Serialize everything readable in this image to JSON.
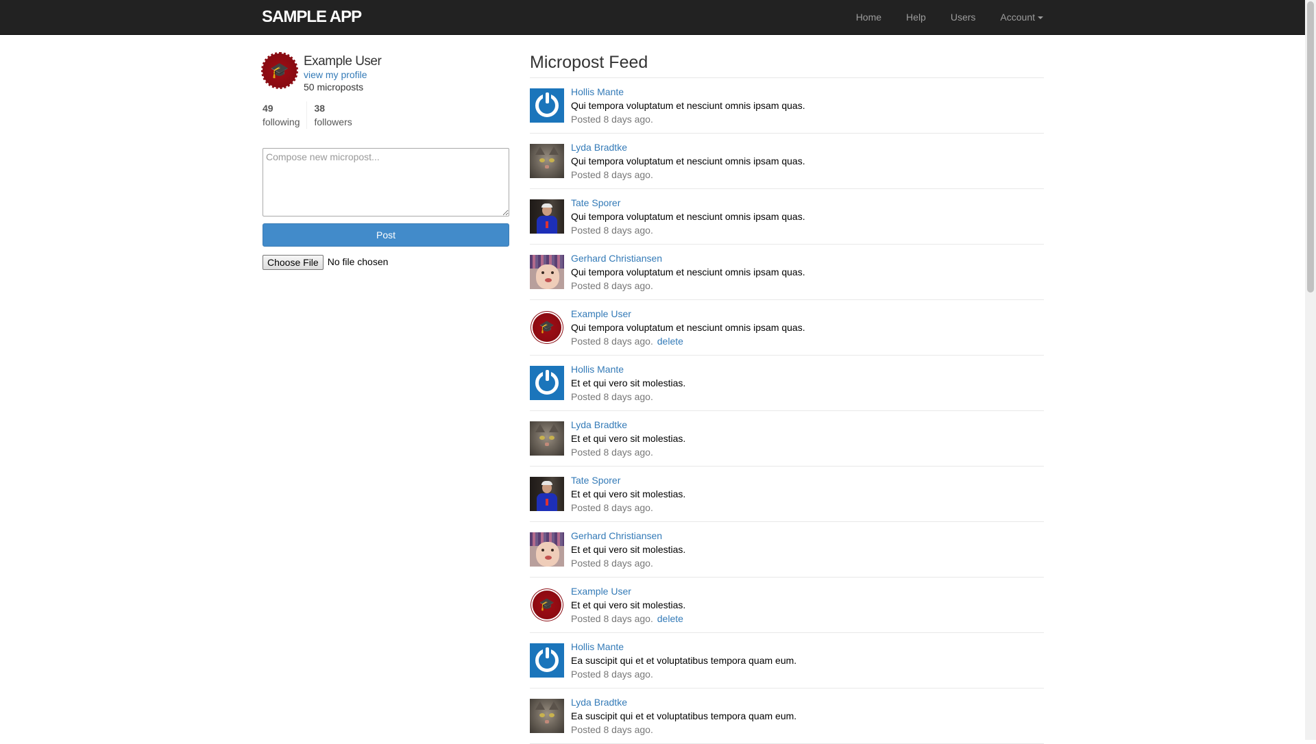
{
  "navbar": {
    "brand": "sample app",
    "links": {
      "home": "Home",
      "help": "Help",
      "users": "Users",
      "account": "Account"
    }
  },
  "sidebar": {
    "user_name": "Example User",
    "profile_link": "view my profile",
    "micropost_count": "50 microposts",
    "stats": {
      "following_count": "49",
      "following_label": "following",
      "followers_count": "38",
      "followers_label": "followers"
    },
    "compose_placeholder": "Compose new micropost...",
    "post_button": "Post",
    "file_button": "Choose File",
    "file_status": "No file chosen"
  },
  "feed": {
    "title": "Micropost Feed",
    "items": [
      {
        "user": "Hollis Mante",
        "avatar": "power-icon",
        "content": "Qui tempora voluptatum et nesciunt omnis ipsam quas.",
        "timestamp": "Posted 8 days ago.",
        "delete": ""
      },
      {
        "user": "Lyda Bradtke",
        "avatar": "cat-photo",
        "content": "Qui tempora voluptatum et nesciunt omnis ipsam quas.",
        "timestamp": "Posted 8 days ago.",
        "delete": ""
      },
      {
        "user": "Tate Sporer",
        "avatar": "man-photo",
        "content": "Qui tempora voluptatum et nesciunt omnis ipsam quas.",
        "timestamp": "Posted 8 days ago.",
        "delete": ""
      },
      {
        "user": "Gerhard Christiansen",
        "avatar": "baby-photo",
        "content": "Qui tempora voluptatum et nesciunt omnis ipsam quas.",
        "timestamp": "Posted 8 days ago.",
        "delete": ""
      },
      {
        "user": "Example User",
        "avatar": "graduation-seal",
        "content": "Qui tempora voluptatum et nesciunt omnis ipsam quas.",
        "timestamp": "Posted 8 days ago.",
        "delete": "delete"
      },
      {
        "user": "Hollis Mante",
        "avatar": "power-icon",
        "content": "Et et qui vero sit molestias.",
        "timestamp": "Posted 8 days ago.",
        "delete": ""
      },
      {
        "user": "Lyda Bradtke",
        "avatar": "cat-photo",
        "content": "Et et qui vero sit molestias.",
        "timestamp": "Posted 8 days ago.",
        "delete": ""
      },
      {
        "user": "Tate Sporer",
        "avatar": "man-photo",
        "content": "Et et qui vero sit molestias.",
        "timestamp": "Posted 8 days ago.",
        "delete": ""
      },
      {
        "user": "Gerhard Christiansen",
        "avatar": "baby-photo",
        "content": "Et et qui vero sit molestias.",
        "timestamp": "Posted 8 days ago.",
        "delete": ""
      },
      {
        "user": "Example User",
        "avatar": "graduation-seal",
        "content": "Et et qui vero sit molestias.",
        "timestamp": "Posted 8 days ago.",
        "delete": "delete"
      },
      {
        "user": "Hollis Mante",
        "avatar": "power-icon",
        "content": "Ea suscipit qui et et voluptatibus tempora quam eum.",
        "timestamp": "Posted 8 days ago.",
        "delete": ""
      },
      {
        "user": "Lyda Bradtke",
        "avatar": "cat-photo",
        "content": "Ea suscipit qui et et voluptatibus tempora quam eum.",
        "timestamp": "Posted 8 days ago.",
        "delete": ""
      }
    ]
  },
  "colors": {
    "navbar_bg": "#222222",
    "link": "#337ab7",
    "post_button": "#428bca",
    "seal_red": "#8c0b12"
  }
}
